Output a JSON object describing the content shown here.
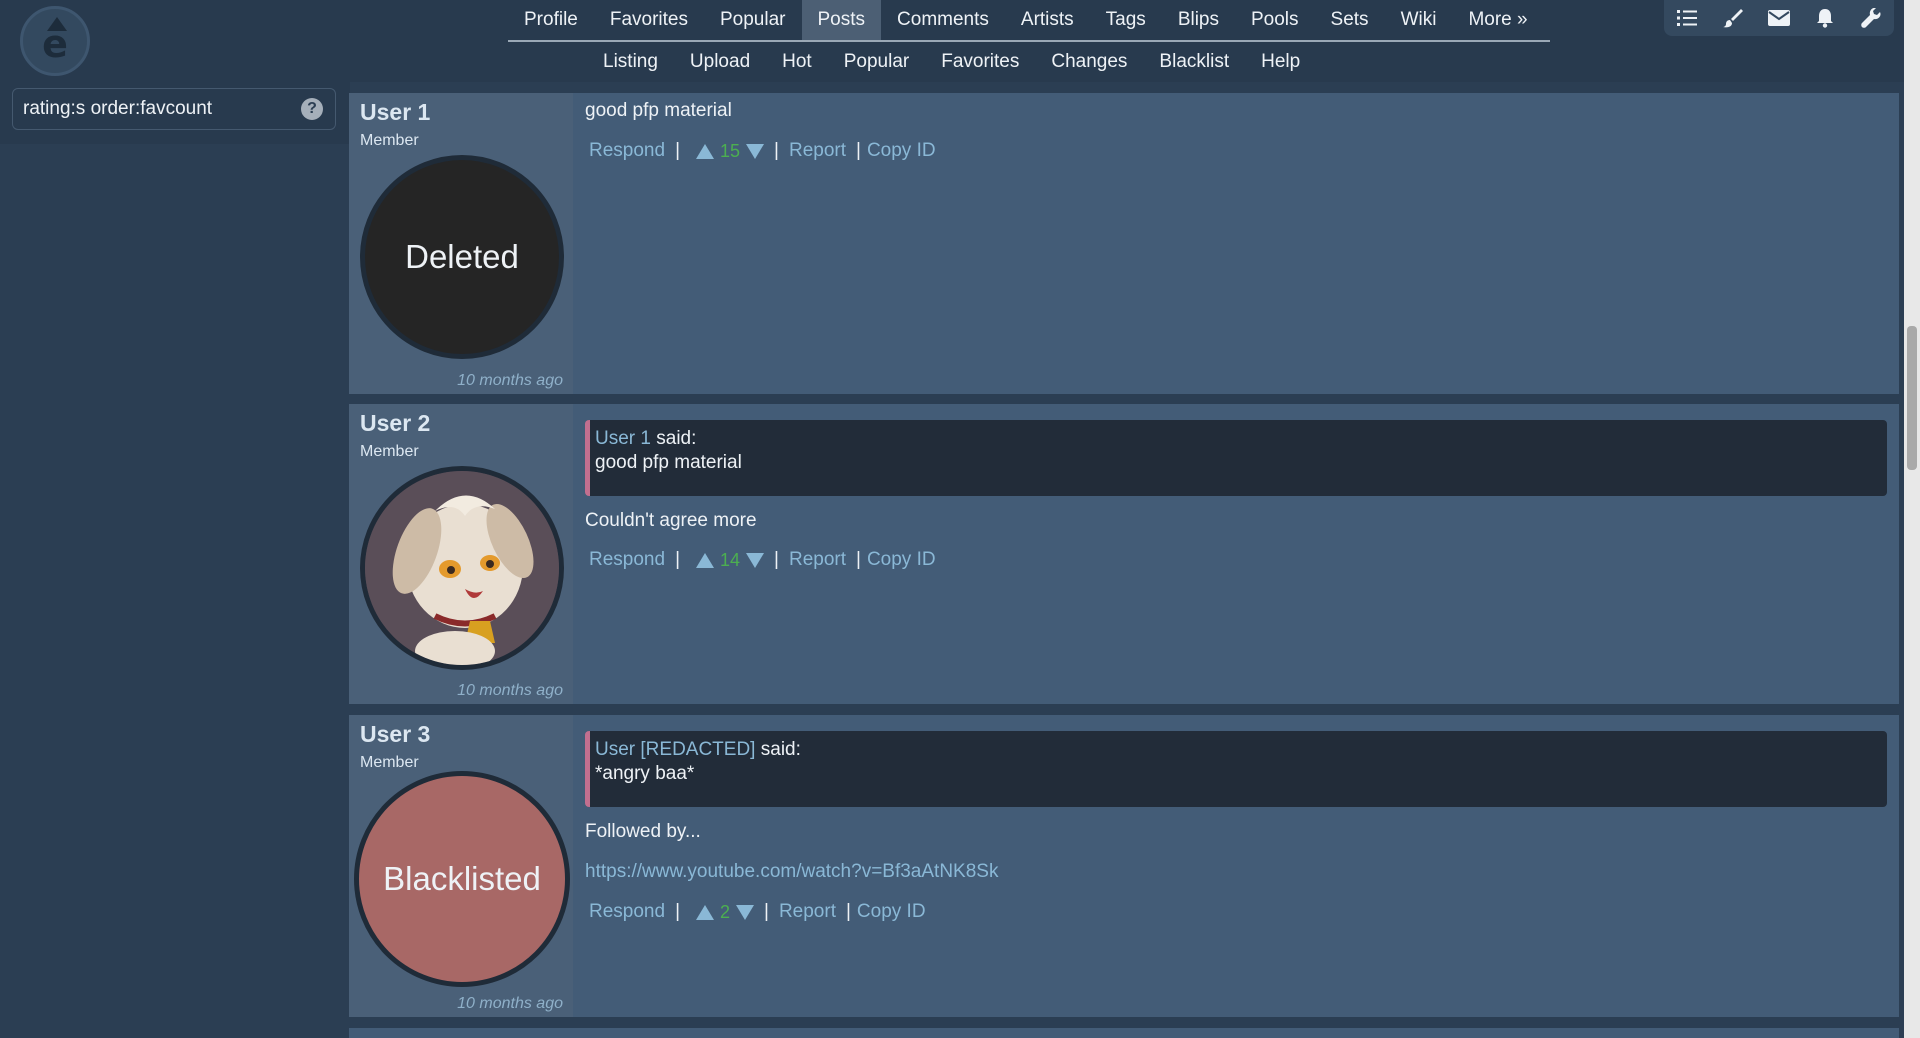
{
  "colors": {
    "background": "#2b3e53",
    "header": "#283a4e",
    "link": "#8ab8d6",
    "score": "#4caf50",
    "quote_border": "#c26f8f"
  },
  "nav": {
    "main": [
      "Profile",
      "Favorites",
      "Popular",
      "Posts",
      "Comments",
      "Artists",
      "Tags",
      "Blips",
      "Pools",
      "Sets",
      "Wiki",
      "More »"
    ],
    "active": "Posts",
    "sub": [
      "Listing",
      "Upload",
      "Hot",
      "Popular",
      "Favorites",
      "Changes",
      "Blacklist",
      "Help"
    ]
  },
  "toolbar": {
    "icons": [
      "list-icon",
      "brush-icon",
      "mail-icon",
      "bell-icon",
      "wrench-icon"
    ]
  },
  "search": {
    "value": "rating:s order:favcount",
    "help": "?"
  },
  "actions": {
    "respond": "Respond",
    "report": "Report",
    "copy_id": "Copy ID",
    "said": "said:"
  },
  "comments": [
    {
      "name": "User 1",
      "level": "Member",
      "avatar_text": "Deleted",
      "time": "10 months ago",
      "text": "good pfp material",
      "score": "15"
    },
    {
      "name": "User 2",
      "level": "Member",
      "avatar_text": "",
      "time": "10 months ago",
      "quote_user": "User 1",
      "quote_text": "good pfp material",
      "text": "Couldn't agree more",
      "score": "14"
    },
    {
      "name": "User 3",
      "level": "Member",
      "avatar_text": "Blacklisted",
      "time": "10 months ago",
      "quote_user": "User [REDACTED]",
      "quote_text": "*angry baa*",
      "text": "Followed by...",
      "link": "https://www.youtube.com/watch?v=Bf3aAtNK8Sk",
      "score": "2"
    }
  ]
}
